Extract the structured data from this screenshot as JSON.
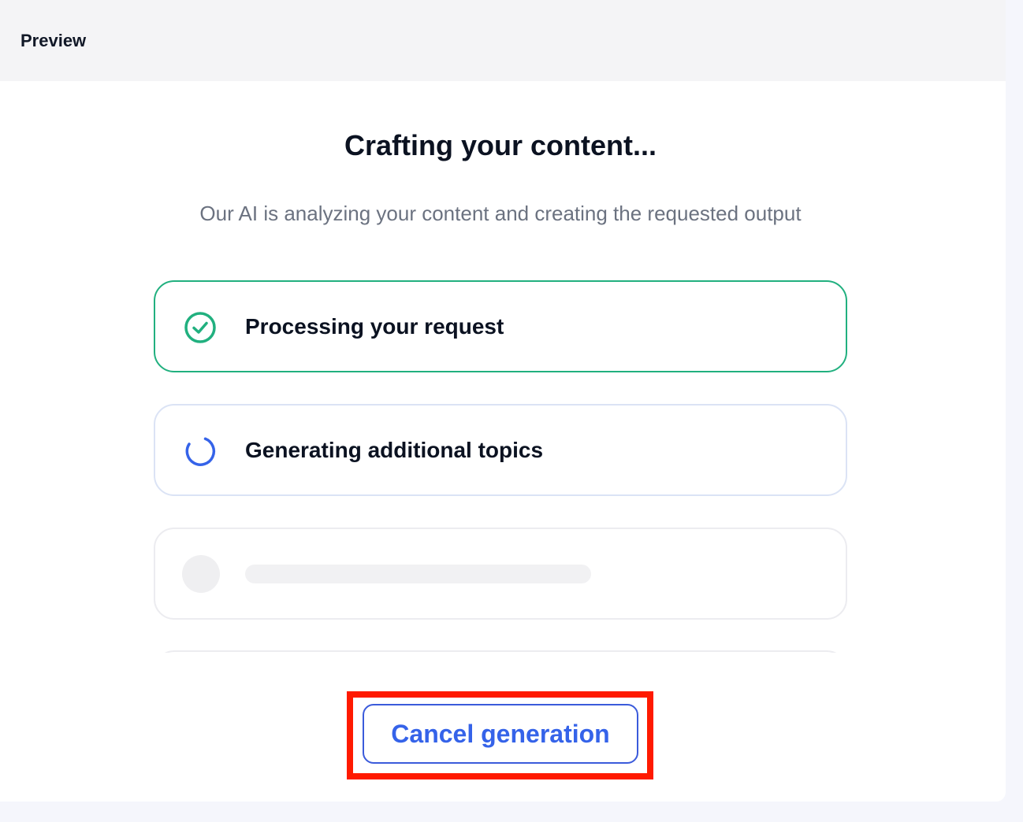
{
  "header": {
    "title": "Preview"
  },
  "main": {
    "title": "Crafting your content...",
    "subtitle": "Our AI is analyzing your content and creating the requested output"
  },
  "steps": [
    {
      "label": "Processing your request",
      "status": "complete",
      "icon": "check-circle-icon"
    },
    {
      "label": "Generating additional topics",
      "status": "in-progress",
      "icon": "spinner-icon"
    },
    {
      "label": "",
      "status": "pending"
    },
    {
      "label": "",
      "status": "pending"
    }
  ],
  "actions": {
    "cancel_label": "Cancel generation"
  },
  "colors": {
    "success": "#21b07f",
    "accent": "#3563e9",
    "highlight": "#ff1a00",
    "muted_text": "#6b7280"
  }
}
